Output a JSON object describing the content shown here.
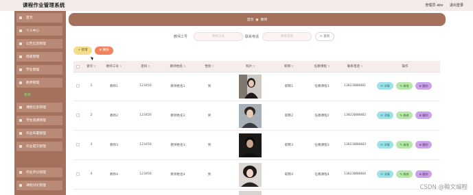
{
  "app": {
    "title": "课程作业管理系统"
  },
  "topbar": {
    "user": "管理员 abo",
    "logout": "退出登录"
  },
  "sidebar": {
    "items": [
      {
        "label": "首页"
      },
      {
        "label": "个人中心"
      },
      {
        "label": "公告信息管理"
      },
      {
        "label": "班级管理"
      },
      {
        "label": "学生管理"
      },
      {
        "label": "教师管理"
      },
      {
        "label": "课程信息管理"
      },
      {
        "label": "学生选课管理"
      },
      {
        "label": "作业布置管理"
      },
      {
        "label": "作业提交管理"
      },
      {
        "label": "作业评分管理"
      },
      {
        "label": "课程讨论管理"
      }
    ],
    "sub_items": [
      {
        "label": "教师"
      }
    ]
  },
  "breadcrumb": {
    "home": "首页",
    "separator": "●",
    "current": "教师"
  },
  "search": {
    "field1_label": "教师工号",
    "field1_placeholder": "教师工号",
    "field2_label": "联系电话",
    "field2_placeholder": "联系电话",
    "button": "查询"
  },
  "toolbar": {
    "add": "+ 新增",
    "delete": "删除"
  },
  "table": {
    "headers": [
      "索引",
      "教师工号",
      "密码",
      "教师姓名",
      "性别",
      "照片",
      "职称",
      "任教课程",
      "联系电话",
      "操作"
    ],
    "rows": [
      {
        "index": "1",
        "id": "教师1",
        "password": "123456",
        "name": "教师姓名1",
        "gender": "男",
        "title": "职称1",
        "course": "任教课程1",
        "phone": "13823888881"
      },
      {
        "index": "2",
        "id": "教师2",
        "password": "123456",
        "name": "教师姓名2",
        "gender": "男",
        "title": "职称2",
        "course": "任教课程2",
        "phone": "13823888882"
      },
      {
        "index": "3",
        "id": "教师3",
        "password": "123456",
        "name": "教师姓名3",
        "gender": "男",
        "title": "职称3",
        "course": "任教课程3",
        "phone": "13823888883"
      },
      {
        "index": "4",
        "id": "教师4",
        "password": "123456",
        "name": "教师姓名4",
        "gender": "男",
        "title": "职称4",
        "course": "任教课程4",
        "phone": "13823888884"
      }
    ],
    "actions": {
      "view": "详情",
      "edit": "修改",
      "delete": "删除"
    }
  },
  "watermark": "CSDN @翰文编程",
  "colors": {
    "sidebar": "#a4725c",
    "breadcrumb": "#a4725c",
    "add_button": "#f3dd8a",
    "delete_button": "#f3835f",
    "view_action": "#9be3e8",
    "edit_action": "#b6e6a8",
    "delete_action": "#c9a3e6"
  }
}
